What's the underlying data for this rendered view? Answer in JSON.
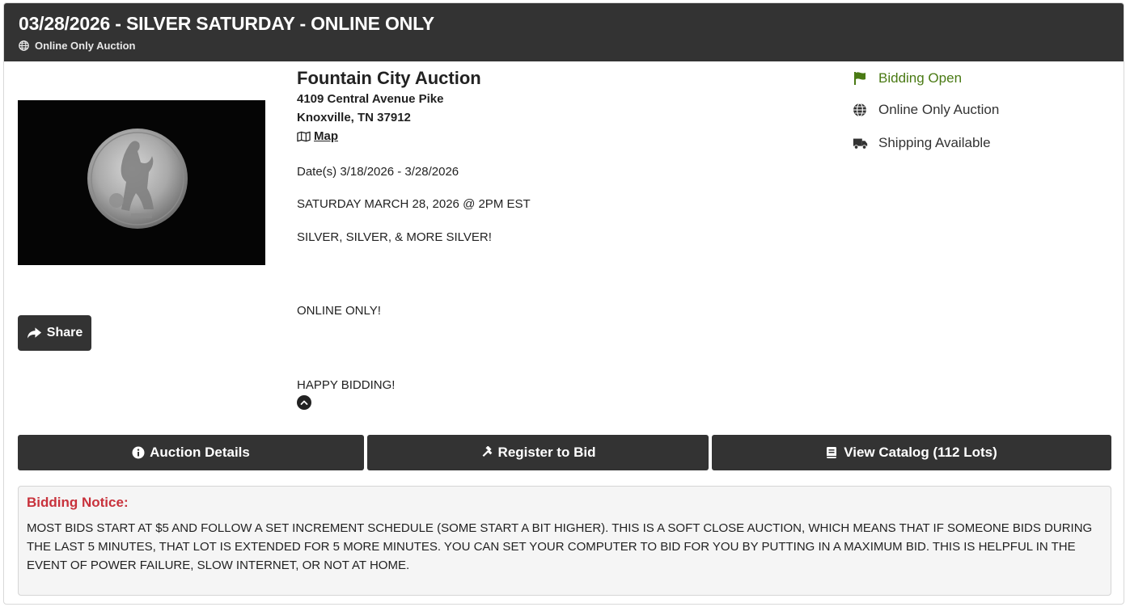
{
  "header": {
    "title": "03/28/2026 - SILVER SATURDAY - ONLINE ONLY",
    "subtitle": "Online Only Auction",
    "subtitle_icon": "globe-icon"
  },
  "photo": {
    "alt": "Walking Liberty half dollar coin on black background"
  },
  "share": {
    "label": "Share",
    "icon": "share-icon"
  },
  "auctioneer": {
    "name": "Fountain City Auction",
    "address_line1": "4109 Central Avenue Pike",
    "address_line2": "Knoxville, TN 37912",
    "map_label": "Map",
    "map_icon": "map-icon"
  },
  "details": {
    "dates": "Date(s) 3/18/2026 - 3/28/2026",
    "lines": [
      "SATURDAY MARCH 28, 2026 @ 2PM EST",
      "SILVER, SILVER, & MORE SILVER!",
      "ONLINE ONLY!",
      "HAPPY BIDDING!"
    ],
    "collapse_icon": "chevron-up-icon"
  },
  "status": {
    "items": [
      {
        "label": "Bidding Open",
        "icon": "flag-icon",
        "color": "#4a7a14"
      },
      {
        "label": "Online Only Auction",
        "icon": "globe-icon",
        "color": "#333333"
      },
      {
        "label": "Shipping Available",
        "icon": "truck-icon",
        "color": "#333333"
      }
    ]
  },
  "buttons": {
    "auction_details": "Auction Details",
    "register": "Register to Bid",
    "catalog": "View Catalog (112 Lots)"
  },
  "notice": {
    "title": "Bidding Notice:",
    "text": "MOST BIDS START AT $5 AND FOLLOW A SET INCREMENT SCHEDULE (SOME START A BIT HIGHER). THIS IS A SOFT CLOSE AUCTION, WHICH MEANS THAT IF SOMEONE BIDS DURING THE LAST 5 MINUTES, THAT LOT IS EXTENDED FOR 5 MORE MINUTES. YOU CAN SET YOUR COMPUTER TO BID FOR YOU BY PUTTING IN A MAXIMUM BID. THIS IS HELPFUL IN THE EVENT OF POWER FAILURE, SLOW INTERNET, OR NOT AT HOME."
  },
  "colors": {
    "header_bg": "#333333",
    "button_bg": "#333333",
    "notice_title": "#c8323c",
    "status_open": "#4a7a14"
  }
}
